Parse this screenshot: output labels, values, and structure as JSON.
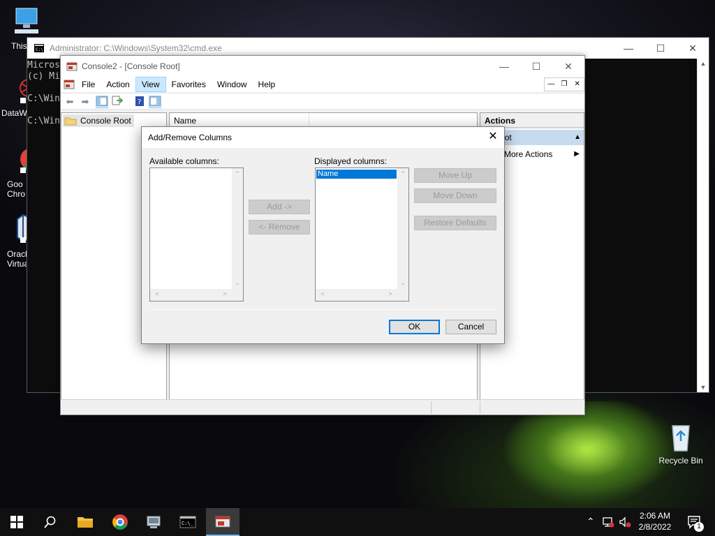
{
  "desktop": {
    "icons": [
      {
        "label": "This"
      },
      {
        "label": "DataW"
      },
      {
        "label": "Goo Chro"
      },
      {
        "label": "Oracl Virtua"
      },
      {
        "label": "Recycle Bin"
      }
    ]
  },
  "cmd_window": {
    "title": "Administrator: C:\\Windows\\System32\\cmd.exe",
    "lines": [
      "Micros",
      "(c) Mi",
      "",
      "C:\\Win",
      "",
      "C:\\Win"
    ]
  },
  "console_window": {
    "title": "Console2 - [Console Root]",
    "menu": [
      "File",
      "Action",
      "View",
      "Favorites",
      "Window",
      "Help"
    ],
    "active_menu": "View",
    "tree_root": "Console Root",
    "list_header": "Name",
    "actions": {
      "header": "Actions",
      "section": "ole Root",
      "more": "More Actions"
    }
  },
  "dialog": {
    "title": "Add/Remove Columns",
    "available_label": "Available columns:",
    "displayed_label": "Displayed columns:",
    "displayed_items": [
      "Name"
    ],
    "add_button": "Add ->",
    "remove_button": "<- Remove",
    "move_up_button": "Move Up",
    "move_down_button": "Move Down",
    "restore_button": "Restore Defaults",
    "ok_button": "OK",
    "cancel_button": "Cancel"
  },
  "taskbar": {
    "clock_time": "2:06 AM",
    "clock_date": "2/8/2022",
    "notification_count": "1"
  },
  "colors": {
    "accent": "#0078d7",
    "menu_highlight": "#cce8ff"
  }
}
